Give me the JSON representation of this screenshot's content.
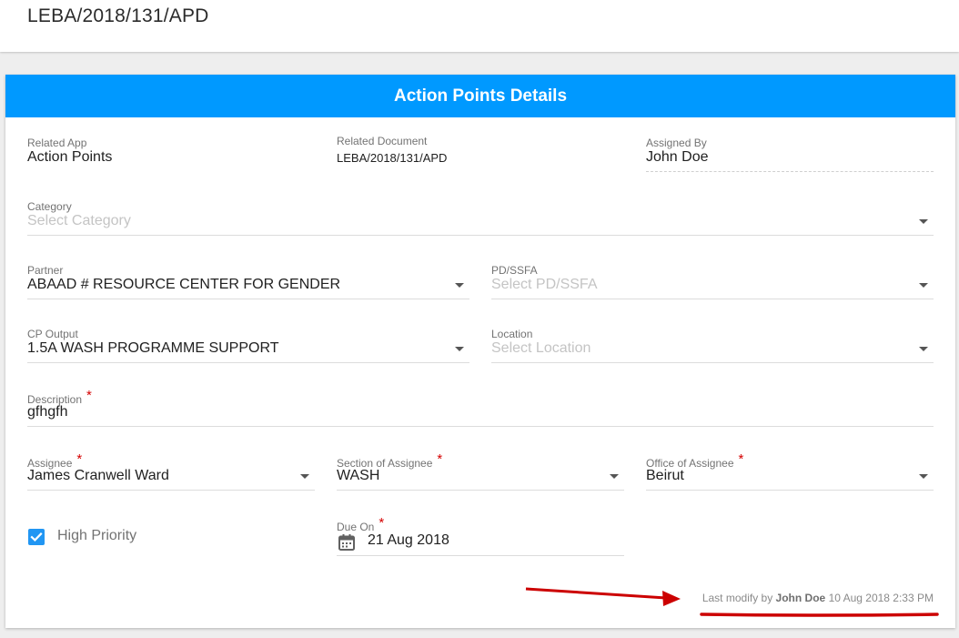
{
  "page": {
    "title": "LEBA/2018/131/APD"
  },
  "card": {
    "header": "Action Points Details"
  },
  "fields": {
    "related_app": {
      "label": "Related App",
      "value": "Action Points"
    },
    "related_document": {
      "label": "Related Document",
      "value": "LEBA/2018/131/APD"
    },
    "assigned_by": {
      "label": "Assigned By",
      "value": "John Doe"
    },
    "category": {
      "label": "Category",
      "placeholder": "Select Category"
    },
    "partner": {
      "label": "Partner",
      "value": "ABAAD # RESOURCE CENTER FOR GENDER"
    },
    "pd_ssfa": {
      "label": "PD/SSFA",
      "placeholder": "Select PD/SSFA"
    },
    "cp_output": {
      "label": "CP Output",
      "value": "1.5A WASH PROGRAMME SUPPORT"
    },
    "location": {
      "label": "Location",
      "placeholder": "Select Location"
    },
    "description": {
      "label": "Description",
      "value": "gfhgfh"
    },
    "assignee": {
      "label": "Assignee",
      "value": "James Cranwell Ward"
    },
    "section_of_assignee": {
      "label": "Section of Assignee",
      "value": "WASH"
    },
    "office_of_assignee": {
      "label": "Office of Assignee",
      "value": "Beirut"
    },
    "high_priority": {
      "label": "High Priority",
      "checked": true
    },
    "due_on": {
      "label": "Due On",
      "value": "21 Aug 2018"
    }
  },
  "required_marker": "*",
  "footer": {
    "prefix": "Last modify by",
    "user": "John Doe",
    "timestamp": "10 Aug 2018 2:33 PM"
  },
  "colors": {
    "header_bg": "#0099ff",
    "checkbox": "#2196f3",
    "required": "#d50000",
    "annotation": "#cc0000"
  },
  "icons": {
    "dropdown": "caret-down-icon",
    "calendar": "calendar-icon",
    "checkbox": "checkmark-icon"
  }
}
